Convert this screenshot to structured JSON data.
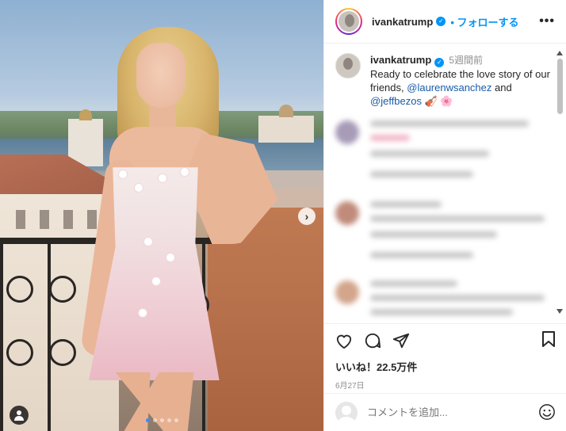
{
  "header": {
    "username": "ivankatrump",
    "follow_label": "フォローする",
    "separator": "•",
    "more": "•••"
  },
  "caption": {
    "username": "ivankatrump",
    "time": "5週間前",
    "text_before": "Ready to celebrate the love story of our friends, ",
    "mention1": "@laurenwsanchez",
    "text_mid": " and ",
    "mention2": "@jeffbezos",
    "emoji": "🎻 🌸"
  },
  "photo": {
    "next_button": "›"
  },
  "actions": {
    "likes": "いいね！22.5万件",
    "date": "6月27日"
  },
  "add_comment": {
    "placeholder": "コメントを追加..."
  },
  "colors": {
    "accent": "#0095f6",
    "mention": "#1a5aa8",
    "muted": "#8e8e8e"
  }
}
